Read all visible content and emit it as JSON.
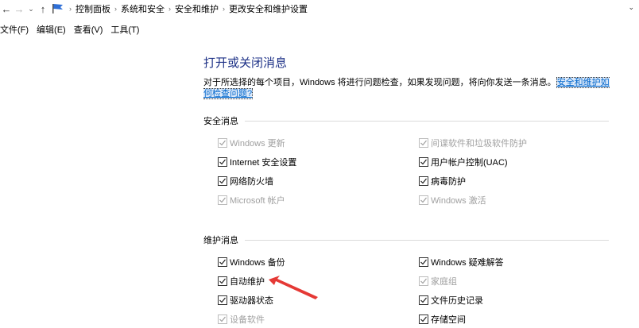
{
  "address_bar": {
    "back_icon": "back-arrow-icon",
    "forward_icon": "forward-arrow-icon",
    "recent_icon": "chevron-down-icon",
    "up_icon": "up-arrow-icon",
    "breadcrumbs": [
      "控制面板",
      "系统和安全",
      "安全和维护",
      "更改安全和维护设置"
    ]
  },
  "menu": {
    "file": "文件(F)",
    "edit": "编辑(E)",
    "view": "查看(V)",
    "tools": "工具(T)"
  },
  "main": {
    "title": "打开或关闭消息",
    "description": "对于所选择的每个项目，Windows 将进行问题检查，如果发现问题，将向你发送一条消息。",
    "link_part1": "安全和维护如",
    "link_part2": "何检查问题?"
  },
  "security": {
    "heading": "安全消息",
    "items": [
      {
        "label": "Windows 更新",
        "checked": true,
        "enabled": false
      },
      {
        "label": "间谍软件和垃圾软件防护",
        "checked": true,
        "enabled": false
      },
      {
        "label": "Internet 安全设置",
        "checked": true,
        "enabled": true
      },
      {
        "label": "用户帐户控制(UAC)",
        "checked": true,
        "enabled": true
      },
      {
        "label": "网络防火墙",
        "checked": true,
        "enabled": true
      },
      {
        "label": "病毒防护",
        "checked": true,
        "enabled": true
      },
      {
        "label": "Microsoft 帐户",
        "checked": true,
        "enabled": false
      },
      {
        "label": "Windows 激活",
        "checked": true,
        "enabled": false
      }
    ]
  },
  "maintenance": {
    "heading": "维护消息",
    "items": [
      {
        "label": "Windows 备份",
        "checked": true,
        "enabled": true
      },
      {
        "label": "Windows 疑难解答",
        "checked": true,
        "enabled": true
      },
      {
        "label": "自动维护",
        "checked": true,
        "enabled": true
      },
      {
        "label": "家庭组",
        "checked": true,
        "enabled": false
      },
      {
        "label": "驱动器状态",
        "checked": true,
        "enabled": true
      },
      {
        "label": "文件历史记录",
        "checked": true,
        "enabled": true
      },
      {
        "label": "设备软件",
        "checked": true,
        "enabled": false
      },
      {
        "label": "存储空间",
        "checked": true,
        "enabled": true
      }
    ]
  },
  "annotation": {
    "arrow_color": "#e53935"
  }
}
